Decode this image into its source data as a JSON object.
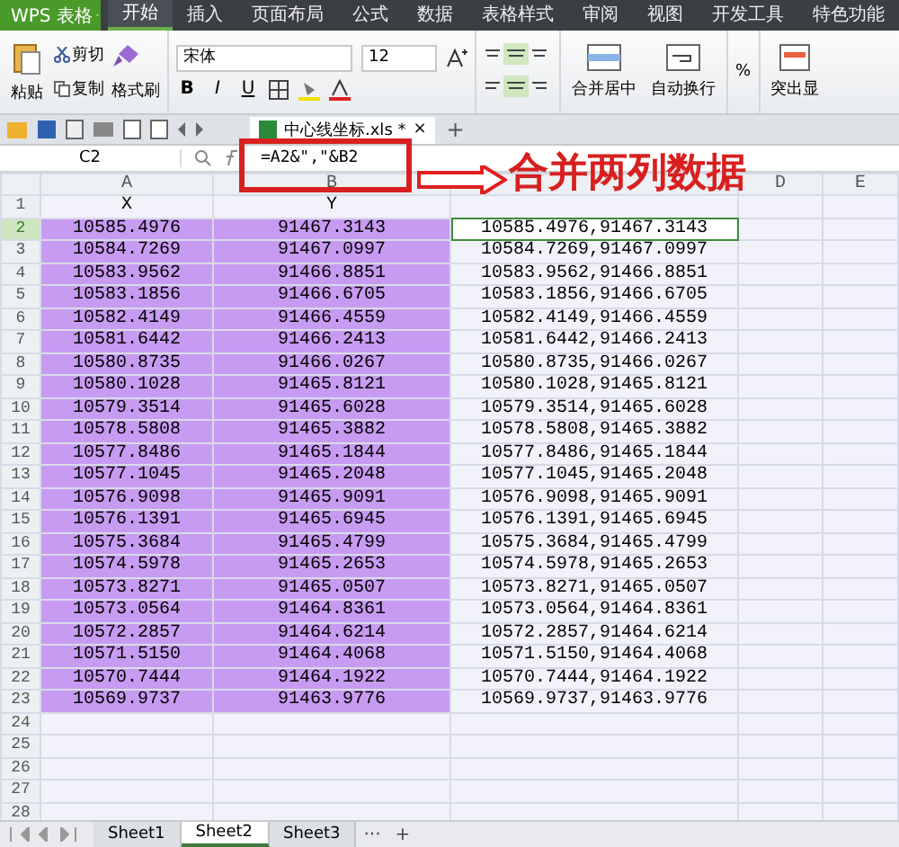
{
  "app": {
    "title": "WPS 表格"
  },
  "menu_tabs": [
    {
      "label": "开始",
      "selected": true
    },
    {
      "label": "插入",
      "selected": false
    },
    {
      "label": "页面布局",
      "selected": false
    },
    {
      "label": "公式",
      "selected": false
    },
    {
      "label": "数据",
      "selected": false
    },
    {
      "label": "表格样式",
      "selected": false
    },
    {
      "label": "审阅",
      "selected": false
    },
    {
      "label": "视图",
      "selected": false
    },
    {
      "label": "开发工具",
      "selected": false
    },
    {
      "label": "特色功能",
      "selected": false
    }
  ],
  "ribbon": {
    "paste": "粘贴",
    "cut": "剪切",
    "copy": "复制",
    "format_painter": "格式刷",
    "font": "宋体",
    "font_size": "12",
    "bold": "B",
    "italic": "I",
    "underline": "U",
    "merge": "合并居中",
    "wrap": "自动换行",
    "percent": "%",
    "highlight": "突出显"
  },
  "doc_tab": {
    "title": "中心线坐标.xls *",
    "close": "×",
    "add": "+"
  },
  "formula_bar": {
    "cell": "C2",
    "formula": "=A2&\",\"&B2"
  },
  "annotation": {
    "text": "合并两列数据"
  },
  "columns": [
    {
      "label": "A"
    },
    {
      "label": "B"
    },
    {},
    {
      "label": "D"
    },
    {
      "label": "E"
    }
  ],
  "rows": [
    {
      "number": "1",
      "a": "X",
      "b": "Y",
      "highlighted": false,
      "selected": false
    },
    {
      "number": "2",
      "a": "10585.4976",
      "b": "91467.3143",
      "c": "10585.4976,91467.3143",
      "highlighted": true,
      "selected": true
    },
    {
      "number": "3",
      "a": "10584.7269",
      "b": "91467.0997",
      "c": "10584.7269,91467.0997",
      "highlighted": true,
      "selected": false
    },
    {
      "number": "4",
      "a": "10583.9562",
      "b": "91466.8851",
      "c": "10583.9562,91466.8851",
      "highlighted": true,
      "selected": false
    },
    {
      "number": "5",
      "a": "10583.1856",
      "b": "91466.6705",
      "c": "10583.1856,91466.6705",
      "highlighted": true,
      "selected": false
    },
    {
      "number": "6",
      "a": "10582.4149",
      "b": "91466.4559",
      "c": "10582.4149,91466.4559",
      "highlighted": true,
      "selected": false
    },
    {
      "number": "7",
      "a": "10581.6442",
      "b": "91466.2413",
      "c": "10581.6442,91466.2413",
      "highlighted": true,
      "selected": false
    },
    {
      "number": "8",
      "a": "10580.8735",
      "b": "91466.0267",
      "c": "10580.8735,91466.0267",
      "highlighted": true,
      "selected": false
    },
    {
      "number": "9",
      "a": "10580.1028",
      "b": "91465.8121",
      "c": "10580.1028,91465.8121",
      "highlighted": true,
      "selected": false
    },
    {
      "number": "10",
      "a": "10579.3514",
      "b": "91465.6028",
      "c": "10579.3514,91465.6028",
      "highlighted": true,
      "selected": false
    },
    {
      "number": "11",
      "a": "10578.5808",
      "b": "91465.3882",
      "c": "10578.5808,91465.3882",
      "highlighted": true,
      "selected": false
    },
    {
      "number": "12",
      "a": "10577.8486",
      "b": "91465.1844",
      "c": "10577.8486,91465.1844",
      "highlighted": true,
      "selected": false
    },
    {
      "number": "13",
      "a": "10577.1045",
      "b": "91465.2048",
      "c": "10577.1045,91465.2048",
      "highlighted": true,
      "selected": false
    },
    {
      "number": "14",
      "a": "10576.9098",
      "b": "91465.9091",
      "c": "10576.9098,91465.9091",
      "highlighted": true,
      "selected": false
    },
    {
      "number": "15",
      "a": "10576.1391",
      "b": "91465.6945",
      "c": "10576.1391,91465.6945",
      "highlighted": true,
      "selected": false
    },
    {
      "number": "16",
      "a": "10575.3684",
      "b": "91465.4799",
      "c": "10575.3684,91465.4799",
      "highlighted": true,
      "selected": false
    },
    {
      "number": "17",
      "a": "10574.5978",
      "b": "91465.2653",
      "c": "10574.5978,91465.2653",
      "highlighted": true,
      "selected": false
    },
    {
      "number": "18",
      "a": "10573.8271",
      "b": "91465.0507",
      "c": "10573.8271,91465.0507",
      "highlighted": true,
      "selected": false
    },
    {
      "number": "19",
      "a": "10573.0564",
      "b": "91464.8361",
      "c": "10573.0564,91464.8361",
      "highlighted": true,
      "selected": false
    },
    {
      "number": "20",
      "a": "10572.2857",
      "b": "91464.6214",
      "c": "10572.2857,91464.6214",
      "highlighted": true,
      "selected": false
    },
    {
      "number": "21",
      "a": "10571.5150",
      "b": "91464.4068",
      "c": "10571.5150,91464.4068",
      "highlighted": true,
      "selected": false
    },
    {
      "number": "22",
      "a": "10570.7444",
      "b": "91464.1922",
      "c": "10570.7444,91464.1922",
      "highlighted": true,
      "selected": false
    },
    {
      "number": "23",
      "a": "10569.9737",
      "b": "91463.9776",
      "c": "10569.9737,91463.9776",
      "highlighted": true,
      "selected": false
    },
    {
      "number": "24",
      "highlighted": false,
      "selected": false
    },
    {
      "number": "25",
      "highlighted": false,
      "selected": false
    },
    {
      "number": "26",
      "highlighted": false,
      "selected": false
    },
    {
      "number": "27",
      "highlighted": false,
      "selected": false
    },
    {
      "number": "28",
      "highlighted": false,
      "selected": false
    }
  ],
  "sheets": [
    {
      "name": "Sheet1",
      "selected": false
    },
    {
      "name": "Sheet2",
      "selected": true
    },
    {
      "name": "Sheet3",
      "selected": false
    }
  ],
  "sheet_more": "···",
  "sheet_add": "+"
}
